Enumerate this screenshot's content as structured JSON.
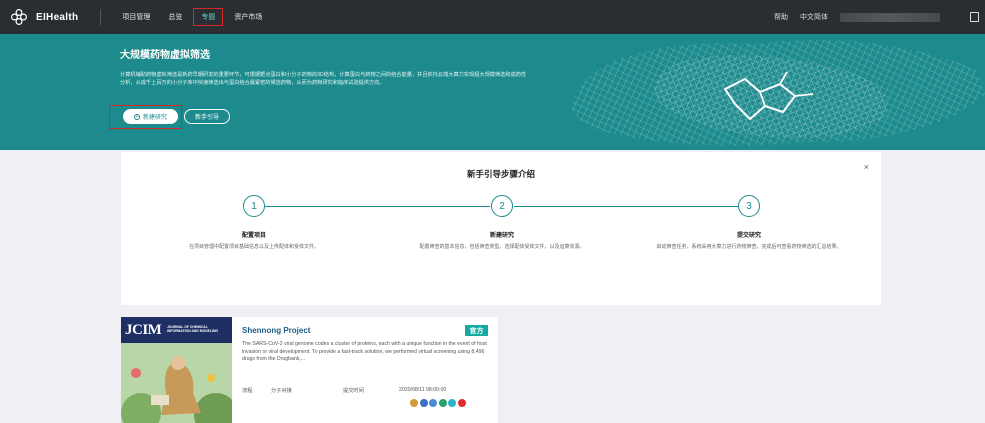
{
  "app": {
    "name": "EIHealth"
  },
  "nav": {
    "items": [
      {
        "label": "项目管理",
        "active": false
      },
      {
        "label": "总览",
        "active": false
      },
      {
        "label": "专题",
        "active": true
      },
      {
        "label": "资产市场",
        "active": false
      }
    ]
  },
  "top_right": {
    "help": "帮助",
    "language": "中文简体"
  },
  "banner": {
    "title": "大规模药物虚拟筛选",
    "description": "计算机辅助药物虚拟筛选是新药早期研发的重要环节，可根据靶点蛋白和小分子药物的3D结构，计算蛋白与药物之间的结合能量，并且依托云端大算力实现超大规模筛选和成药性分析，从成千上百万的小分子库中快速筛选出与蛋白结合最紧密的候选药物，从而为药物研究和临床试验提供方向。",
    "new_button": "新建研究",
    "guide_button": "新手引导",
    "color": "#1d8a8d"
  },
  "guide": {
    "title": "新手引导步骤介绍",
    "close": "×",
    "steps": [
      {
        "number": "1",
        "title": "配置项目",
        "desc": "在项目管理中配置项目基础信息以及上传配体和受体文件。"
      },
      {
        "number": "2",
        "title": "新建研究",
        "desc": "配置筛查的基本信息，包括筛查类型、选择配体受体文件，以及运算资源。"
      },
      {
        "number": "3",
        "title": "提交研究",
        "desc": "启动筛查任务，系统采用大算力进行药物筛查，完成后可查看药物筛选的汇总结果。"
      }
    ]
  },
  "card": {
    "cover_title": "JCIM",
    "cover_subtitle": "JOURNAL OF CHEMICAL INFORMATION AND MODELING",
    "title": "Shennong Project",
    "badge": "官方",
    "description": "The SARS-CoV-2 viral genome codes a cluster of proteins, each with a unique function in the event of host invasion or viral development. To provide a fast-track solution, we performed virtual screening using 8,496 drugs from the Drugbank,...",
    "meta_label_1": "流程",
    "meta_value_1": "分子对接",
    "meta_label_2": "提交时间",
    "meta_value_2": "2020/08/11 08:00:00"
  }
}
